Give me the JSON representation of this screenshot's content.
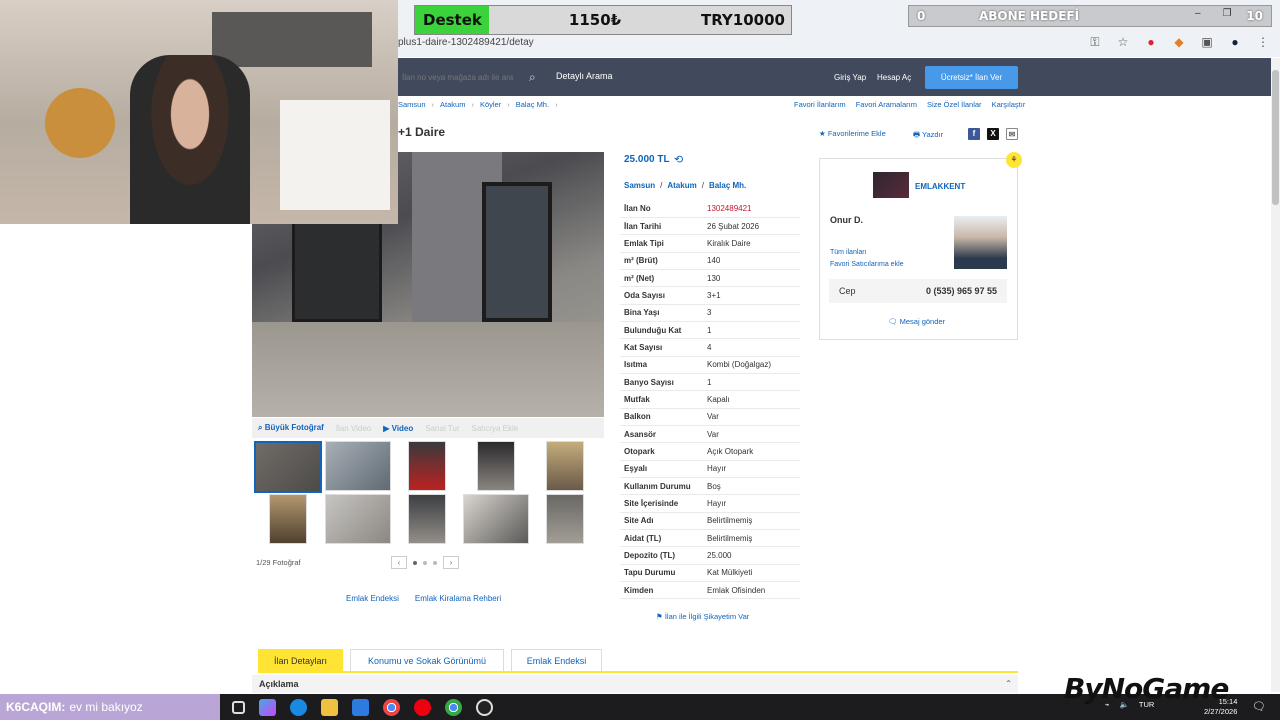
{
  "browser": {
    "url": "plus1-daire-1302489421/detay",
    "icons": [
      "key-icon",
      "star-icon",
      "extension-badge-icon",
      "metamask-icon",
      "puzzle-icon",
      "profile-icon",
      "menu-icon"
    ]
  },
  "overlay": {
    "donate_label": "Destek",
    "donate_amount": "1150₺",
    "donate_goal": "TRY10000",
    "sub_current": "0",
    "sub_label": "ABONE HEDEFİ",
    "sub_target": "10",
    "chat_user": "K6CAQIM:",
    "chat_message": "ev mi bakıyoz",
    "brand": "ByNoGame"
  },
  "header": {
    "search_placeholder": "İlan no veya mağaza adı ile ara",
    "detail_search": "Detaylı Arama",
    "login": "Giriş Yap",
    "register": "Hesap Aç",
    "free_ad": "Ücretsiz* İlan Ver"
  },
  "breadcrumbs": [
    "Samsun",
    "Atakum",
    "Köyler",
    "Balaç Mh."
  ],
  "top_links": [
    "Favori İlanlarım",
    "Favori Aramalarım",
    "Size Özel İlanlar",
    "Karşılaştır"
  ],
  "listing": {
    "title": "+1 Daire",
    "fav_add": "Favorilerime Ekle",
    "print": "Yazdır",
    "price": "25.000 TL",
    "location": [
      "Samsun",
      "Atakum",
      "Balaç Mh."
    ],
    "fields": [
      {
        "k": "İlan No",
        "v": "1302489421"
      },
      {
        "k": "İlan Tarihi",
        "v": "26 Şubat 2026"
      },
      {
        "k": "Emlak Tipi",
        "v": "Kiralık Daire"
      },
      {
        "k": "m² (Brüt)",
        "v": "140"
      },
      {
        "k": "m² (Net)",
        "v": "130"
      },
      {
        "k": "Oda Sayısı",
        "v": "3+1"
      },
      {
        "k": "Bina Yaşı",
        "v": "3"
      },
      {
        "k": "Bulunduğu Kat",
        "v": "1"
      },
      {
        "k": "Kat Sayısı",
        "v": "4"
      },
      {
        "k": "Isıtma",
        "v": "Kombi (Doğalgaz)"
      },
      {
        "k": "Banyo Sayısı",
        "v": "1"
      },
      {
        "k": "Mutfak",
        "v": "Kapalı"
      },
      {
        "k": "Balkon",
        "v": "Var"
      },
      {
        "k": "Asansör",
        "v": "Var"
      },
      {
        "k": "Otopark",
        "v": "Açık Otopark"
      },
      {
        "k": "Eşyalı",
        "v": "Hayır"
      },
      {
        "k": "Kullanım Durumu",
        "v": "Boş"
      },
      {
        "k": "Site İçerisinde",
        "v": "Hayır"
      },
      {
        "k": "Site Adı",
        "v": "Belirtilmemiş"
      },
      {
        "k": "Aidat (TL)",
        "v": "Belirtilmemiş"
      },
      {
        "k": "Depozito (TL)",
        "v": "25.000"
      },
      {
        "k": "Tapu Durumu",
        "v": "Kat Mülkiyeti"
      },
      {
        "k": "Kimden",
        "v": "Emlak Ofisinden"
      }
    ],
    "complaint": "İlan ile İlgili Şikayetim Var"
  },
  "photos": {
    "tools": [
      "Büyük Fotoğraf",
      "İlan Video",
      "Video",
      "Sanal Tur",
      "Satıcıya Ekle"
    ],
    "count": "1/29 Fotoğraf",
    "links": [
      "Emlak Endeksi",
      "Emlak Kiralama Rehberi"
    ]
  },
  "seller": {
    "store": "EMLAKKENT",
    "owner": "Onur D.",
    "all_ads": "Tüm ilanları",
    "fav_seller": "Favori Satıcılarıma ekle",
    "phone_label": "Cep",
    "phone": "0 (535) 965 97 55",
    "message": "Mesaj gönder"
  },
  "tabs": [
    "İlan Detayları",
    "Konumu ve Sokak Görünümü",
    "Emlak Endeksi"
  ],
  "description_title": "Açıklama",
  "clock": {
    "time": "15:14",
    "date": "2/27/2026"
  },
  "lang": "TUR"
}
